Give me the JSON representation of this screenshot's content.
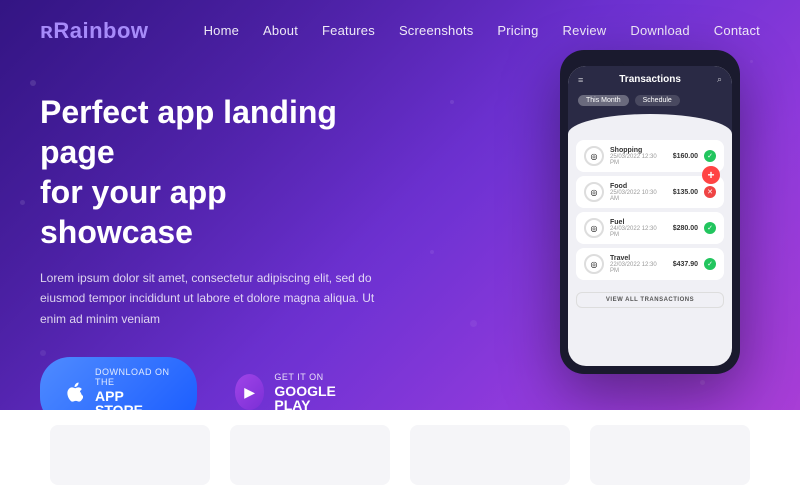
{
  "brand": {
    "name": "Rainbow"
  },
  "nav": {
    "links": [
      {
        "label": "Home",
        "id": "home"
      },
      {
        "label": "About",
        "id": "about"
      },
      {
        "label": "Features",
        "id": "features"
      },
      {
        "label": "Screenshots",
        "id": "screenshots"
      },
      {
        "label": "Pricing",
        "id": "pricing"
      },
      {
        "label": "Review",
        "id": "review"
      },
      {
        "label": "Download",
        "id": "download"
      },
      {
        "label": "Contact",
        "id": "contact"
      }
    ]
  },
  "hero": {
    "title_line1": "Perfect app landing page",
    "title_line2": "for your app showcase",
    "subtitle": "Lorem ipsum dolor sit amet, consectetur adipiscing elit, sed do eiusmod tempor incididunt ut labore et dolore magna aliqua. Ut enim ad minim veniam",
    "btn_appstore_label": "APP STORE",
    "btn_appstore_sublabel": "DOWNLOAD ON THE",
    "btn_googleplay_label": "GOOGLE PLAY",
    "btn_googleplay_sublabel": "GET IT ON"
  },
  "phone": {
    "header_title": "Transactions",
    "filter_month": "This Month",
    "filter_schedule": "Schedule",
    "fab_icon": "+",
    "transactions": [
      {
        "name": "Shopping",
        "date": "25/03/2022 12:30 PM",
        "amount": "$160.00",
        "status": "green",
        "icon": "◎"
      },
      {
        "name": "Food",
        "date": "25/03/2022 10:30 AM",
        "amount": "$135.00",
        "status": "red",
        "icon": "◎"
      },
      {
        "name": "Fuel",
        "date": "24/03/2022 12:30 PM",
        "amount": "$280.00",
        "status": "green",
        "icon": "◎"
      },
      {
        "name": "Travel",
        "date": "22/03/2022 12:30 PM",
        "amount": "$437.90",
        "status": "green",
        "icon": "◎"
      }
    ],
    "view_all_label": "VIEW ALL TRANSACTIONS"
  },
  "colors": {
    "accent_blue": "#4f8bff",
    "accent_purple": "#a044e8",
    "nav_text": "rgba(255,255,255,0.9)"
  }
}
